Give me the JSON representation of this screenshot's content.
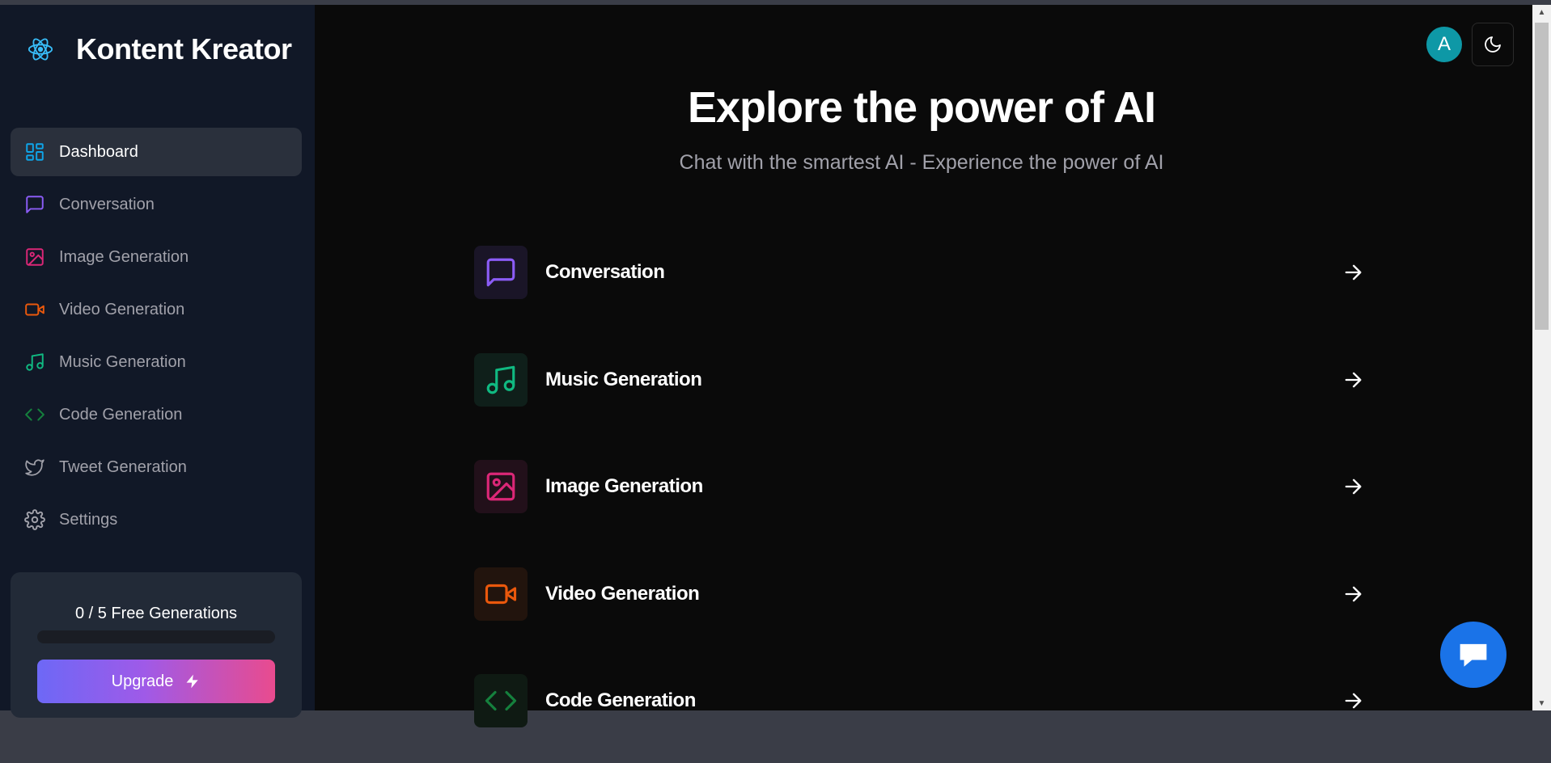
{
  "brand": {
    "title": "Kontent Kreator",
    "icon": "atom-icon"
  },
  "sidebar": {
    "items": [
      {
        "label": "Dashboard",
        "icon": "dashboard-icon",
        "color": "#0ea5e9",
        "active": true
      },
      {
        "label": "Conversation",
        "icon": "message-square-icon",
        "color": "#8b5cf6"
      },
      {
        "label": "Image Generation",
        "icon": "image-icon",
        "color": "#db2777"
      },
      {
        "label": "Video Generation",
        "icon": "video-icon",
        "color": "#ea580c"
      },
      {
        "label": "Music Generation",
        "icon": "music-icon",
        "color": "#10b981"
      },
      {
        "label": "Code Generation",
        "icon": "code-icon",
        "color": "#15803d"
      },
      {
        "label": "Tweet Generation",
        "icon": "twitter-icon",
        "color": "#a1a1aa"
      },
      {
        "label": "Settings",
        "icon": "settings-icon",
        "color": "#a1a1aa"
      }
    ]
  },
  "promo": {
    "text": "0 / 5 Free Generations",
    "progress": 0,
    "upgrade_label": "Upgrade"
  },
  "header": {
    "avatar_letter": "A",
    "theme_icon": "moon-icon"
  },
  "hero": {
    "title": "Explore the power of AI",
    "subtitle": "Chat with the smartest AI - Experience the power of AI"
  },
  "tools": [
    {
      "label": "Conversation",
      "icon": "message-square-icon",
      "color": "#8b5cf6",
      "bg": "#1a1527"
    },
    {
      "label": "Music Generation",
      "icon": "music-icon",
      "color": "#10b981",
      "bg": "#0f1f1a"
    },
    {
      "label": "Image Generation",
      "icon": "image-icon",
      "color": "#db2777",
      "bg": "#22101a"
    },
    {
      "label": "Video Generation",
      "icon": "video-icon",
      "color": "#ea580c",
      "bg": "#22140d"
    },
    {
      "label": "Code Generation",
      "icon": "code-icon",
      "color": "#15803d",
      "bg": "#0f1a13"
    }
  ],
  "chat_widget": {
    "icon": "chat-bubble-icon"
  }
}
